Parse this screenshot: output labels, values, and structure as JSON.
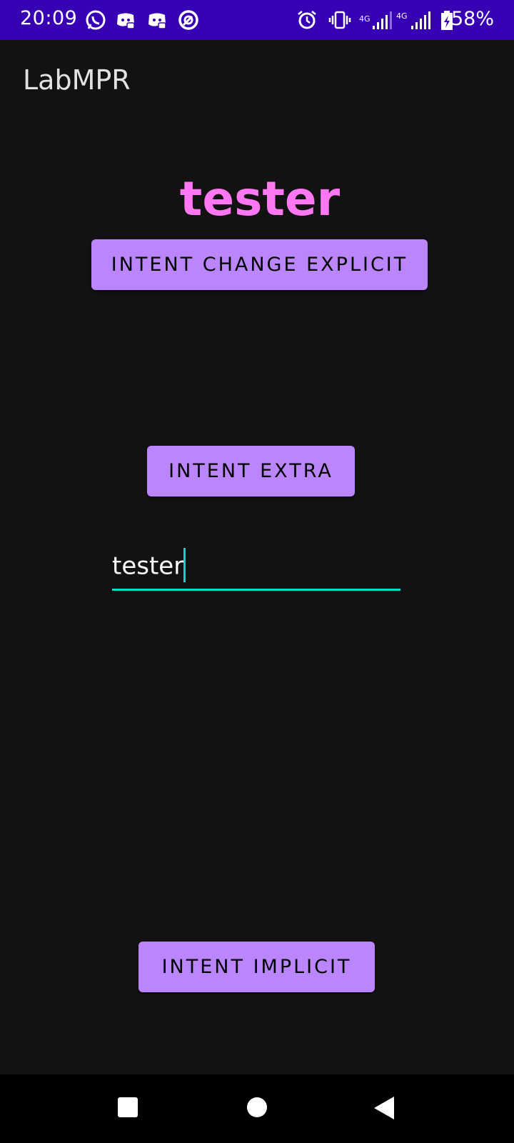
{
  "status_bar": {
    "time": "20:09",
    "battery_percent": "58%",
    "network_1": "4G",
    "network_2": "4G",
    "left_icons": [
      "whatsapp-icon",
      "discord-icon",
      "discord-icon",
      "app-icon"
    ],
    "right_icons": [
      "alarm-icon",
      "vibrate-icon",
      "signal-icon",
      "signal-icon",
      "battery-charging-icon"
    ],
    "color": "#3700b3"
  },
  "app_bar": {
    "title": "LabMPR"
  },
  "main": {
    "display_text": "tester",
    "display_text_color": "#ff77f2",
    "buttons": {
      "explicit": "INTENT CHANGE EXPLICIT",
      "extra": "INTENT EXTRA",
      "implicit": "INTENT IMPLICIT"
    },
    "button_color": "#bb86fc",
    "input": {
      "value": "tester",
      "accent": "#03dac5"
    }
  },
  "nav_bar": {
    "buttons": [
      "recents-square-icon",
      "home-circle-icon",
      "back-triangle-icon"
    ]
  },
  "theme": {
    "background": "#121212"
  }
}
